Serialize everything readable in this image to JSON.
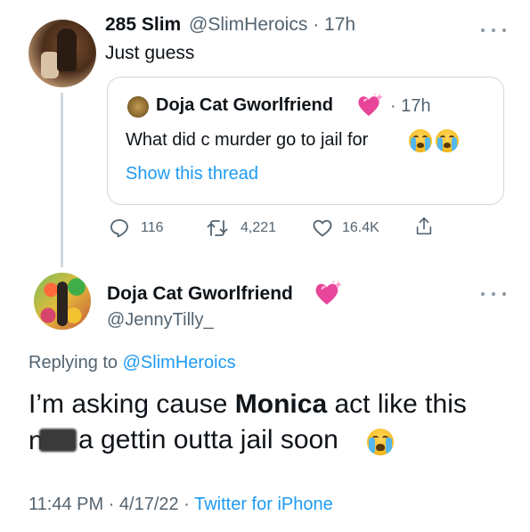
{
  "tweet": {
    "author_name": "285 Slim",
    "author_handle": "@SlimHeroics",
    "separator": "·",
    "time": "17h",
    "text": "Just guess",
    "more_icon": "more-dots-icon",
    "quote": {
      "author_name": "Doja Cat Gworlfriend",
      "name_emoji": "sparkling-heart-icon",
      "separator": "·",
      "time": "17h",
      "text": "What did c murder go to jail for",
      "emojis": [
        "loudly-crying-face-icon",
        "loudly-crying-face-icon"
      ],
      "link": "Show this thread"
    },
    "actions": {
      "replies": "116",
      "retweets": "4,221",
      "likes": "16.4K"
    }
  },
  "reply": {
    "author_name": "Doja Cat Gworlfriend",
    "name_emoji": "sparkling-heart-icon",
    "author_handle": "@JennyTilly_",
    "replying_prefix": "Replying to",
    "replying_to": "@SlimHeroics",
    "text_part1": "I’m asking cause ",
    "text_bold": "Monica",
    "text_part2": " act like this",
    "text_line2_prefix": "n",
    "text_line2_suffix": "a gettin outta jail soon",
    "text_emoji": "loudly-crying-face-icon",
    "time": "11:44 PM",
    "separator": "·",
    "date": "4/17/22",
    "source": "Twitter for iPhone"
  },
  "colors": {
    "accent": "#1d9bf0",
    "secondary_text": "#536471",
    "border": "#cfd9de",
    "heart_pink": "#ff4fa3"
  }
}
